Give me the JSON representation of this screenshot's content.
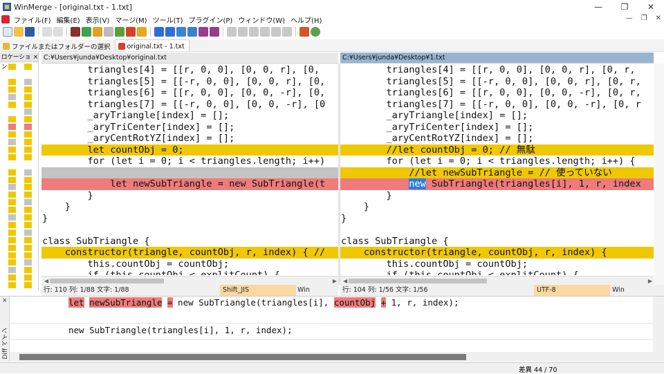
{
  "window": {
    "title": "WinMerge - [original.txt - 1.txt]",
    "controls": {
      "minimize": "—",
      "restore": "❐",
      "close": "✕"
    }
  },
  "menu": {
    "items": [
      "ファイル(F)",
      "編集(E)",
      "表示(V)",
      "マージ(M)",
      "ツール(T)",
      "プラグイン(P)",
      "ウィンドウ(W)",
      "ヘルプ(H)"
    ],
    "right": [
      "—",
      "❐",
      "✕"
    ]
  },
  "tabs": [
    {
      "label": "ファイルまたはフォルダーの選択"
    },
    {
      "label": "original.txt - 1.txt"
    }
  ],
  "location_pane": {
    "title": "ロケーション",
    "close": "×"
  },
  "left_pane": {
    "path": "C:¥Users¥junda¥Desktop¥original.txt",
    "lines": [
      {
        "text": "        triangles[4] = [[r, 0, 0], [0, 0, r], [0,",
        "type": "normal"
      },
      {
        "text": "        triangles[5] = [[-r, 0, 0], [0, 0, r], [0,",
        "type": "normal"
      },
      {
        "text": "        triangles[6] = [[r, 0, 0], [0, 0, -r], [0,",
        "type": "normal"
      },
      {
        "text": "        triangles[7] = [[-r, 0, 0], [0, 0, -r], [0",
        "type": "normal"
      },
      {
        "text": "        _aryTriangle[index] = [];",
        "type": "normal"
      },
      {
        "text": "        _aryTriCenter[index] = [];",
        "type": "normal"
      },
      {
        "text": "        _aryCentRotYZ[index] = [];",
        "type": "normal"
      },
      {
        "text": "        let countObj = 0;",
        "type": "chg"
      },
      {
        "text": "        for (let i = 0; i < triangles.length; i++)",
        "type": "normal"
      },
      {
        "text": "",
        "type": "gray"
      },
      {
        "text": "            let newSubTriangle = new SubTriangle(t",
        "type": "red"
      },
      {
        "text": "        }",
        "type": "normal"
      },
      {
        "text": "    }",
        "type": "normal"
      },
      {
        "text": "}",
        "type": "normal"
      },
      {
        "text": "",
        "type": "normal"
      },
      {
        "text": "class SubTriangle {",
        "type": "normal"
      },
      {
        "text": "    constructor(triangle, countObj, r, index) { //",
        "type": "chg"
      },
      {
        "text": "        this.countObj = countObj;",
        "type": "normal"
      },
      {
        "text": "        if (this.countObj < explitCount) {",
        "type": "normal"
      }
    ],
    "status": {
      "pos": "行: 110  列: 1/88  文字: 1/88",
      "encoding": "Shift_JIS",
      "eol": "Win"
    }
  },
  "right_pane": {
    "path": "C:¥Users¥junda¥Desktop¥1.txt",
    "lines": [
      {
        "text": "        triangles[4] = [[r, 0, 0], [0, 0, r], [0, r,",
        "type": "normal"
      },
      {
        "text": "        triangles[5] = [[-r, 0, 0], [0, 0, r], [0, r,",
        "type": "normal"
      },
      {
        "text": "        triangles[6] = [[r, 0, 0], [0, 0, -r], [0, r,",
        "type": "normal"
      },
      {
        "text": "        triangles[7] = [[-r, 0, 0], [0, 0, -r], [0, r",
        "type": "normal"
      },
      {
        "text": "        _aryTriangle[index] = [];",
        "type": "normal"
      },
      {
        "text": "        _aryTriCenter[index] = [];",
        "type": "normal"
      },
      {
        "text": "        _aryCentRotYZ[index] = [];",
        "type": "normal"
      },
      {
        "text": "        //let countObj = 0; // 無駄",
        "type": "chg"
      },
      {
        "text": "        for (let i = 0; i < triangles.length; i++) {",
        "type": "normal"
      },
      {
        "text": "            //let newSubTriangle = // 使っていない",
        "type": "chg"
      },
      {
        "text": "            new SubTriangle(triangles[i], 1, r, index",
        "type": "red",
        "sel": "new"
      },
      {
        "text": "        }",
        "type": "normal"
      },
      {
        "text": "    }",
        "type": "normal"
      },
      {
        "text": "}",
        "type": "normal"
      },
      {
        "text": "",
        "type": "normal"
      },
      {
        "text": "class SubTriangle {",
        "type": "normal"
      },
      {
        "text": "    constructor(triangle, countObj, r, index) {",
        "type": "chg"
      },
      {
        "text": "        this.countObj = countObj;",
        "type": "normal"
      },
      {
        "text": "        if (this.countObj < explitCount) {",
        "type": "normal"
      }
    ],
    "status": {
      "pos": "行: 104  列: 1/56  文字: 1/56",
      "encoding": "UTF-8",
      "eol": "Win"
    }
  },
  "diff_pane": {
    "label": "Diff ペイン",
    "close": "×",
    "line1_parts": [
      {
        "t": "let",
        "red": true
      },
      {
        "t": " ",
        "red": false
      },
      {
        "t": "newSubTriangle",
        "red": true
      },
      {
        "t": " ",
        "red": false
      },
      {
        "t": "=",
        "red": true
      },
      {
        "t": " new SubTriangle(triangles[i], ",
        "red": false
      },
      {
        "t": "countObj",
        "red": true
      },
      {
        "t": " ",
        "red": false
      },
      {
        "t": "+",
        "red": true
      },
      {
        "t": " 1, r, index);",
        "red": false
      }
    ],
    "line2": "new SubTriangle(triangles[i], 1, r, index);"
  },
  "statusbar": {
    "diff_count": "差異 44 / 70"
  },
  "colors": {
    "changed": "#efc800",
    "deleted": "#ef7b7b",
    "missing": "#c4c4c4",
    "selection": "#2b7ee3"
  }
}
